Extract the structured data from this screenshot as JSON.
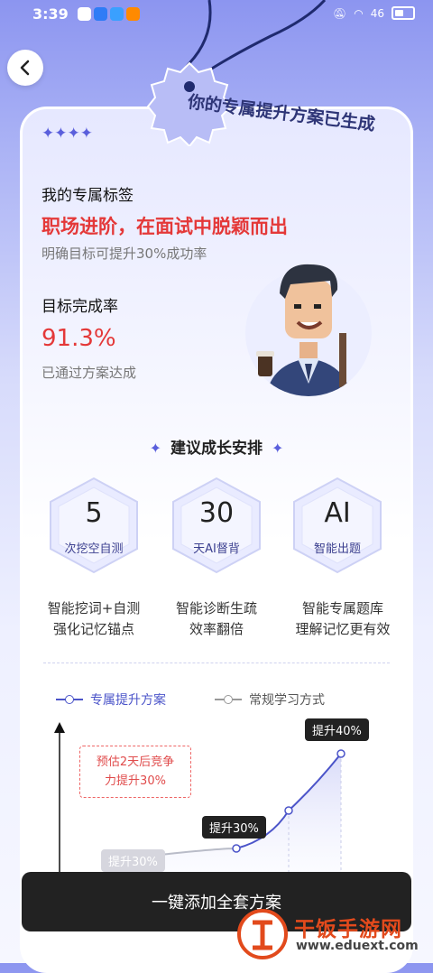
{
  "status_bar": {
    "time": "3:39",
    "network": "46"
  },
  "tag_title": "你的专属提升方案已生成",
  "stars": "✦✦✦✦",
  "profile": {
    "tag_label": "我的专属标签",
    "tag_value": "职场进阶，在面试中脱颖而出",
    "tag_sub": "明确目标可提升30%成功率",
    "rate_label": "目标完成率",
    "rate_value": "91.3%",
    "rate_sub": "已通过方案达成"
  },
  "section": {
    "title": "建议成长安排"
  },
  "features": [
    {
      "number": "5",
      "label": "次挖空自测",
      "desc1": "智能挖词+自测",
      "desc2": "强化记忆锚点"
    },
    {
      "number": "30",
      "label": "天AI督背",
      "desc1": "智能诊断生疏",
      "desc2": "效率翻倍"
    },
    {
      "number": "AI",
      "label": "智能出题",
      "desc1": "智能专属题库",
      "desc2": "理解记忆更有效"
    }
  ],
  "chart_data": {
    "type": "line",
    "series": [
      {
        "name": "专属提升方案",
        "values": [
          30,
          30,
          40
        ],
        "color": "#4b54c9"
      },
      {
        "name": "常规学习方式",
        "values": [
          30
        ],
        "color": "#999999"
      }
    ],
    "labels": [
      "提升30%",
      "提升30%",
      "提升40%"
    ],
    "annotation": "预估2天后竞争力提升30%",
    "annotation_line1": "预估2天后竞争",
    "annotation_line2": "力提升30%"
  },
  "cta": {
    "label": "一键添加全套方案"
  },
  "watermark": {
    "text": "干饭手游网",
    "url": "www.eduext.com"
  }
}
